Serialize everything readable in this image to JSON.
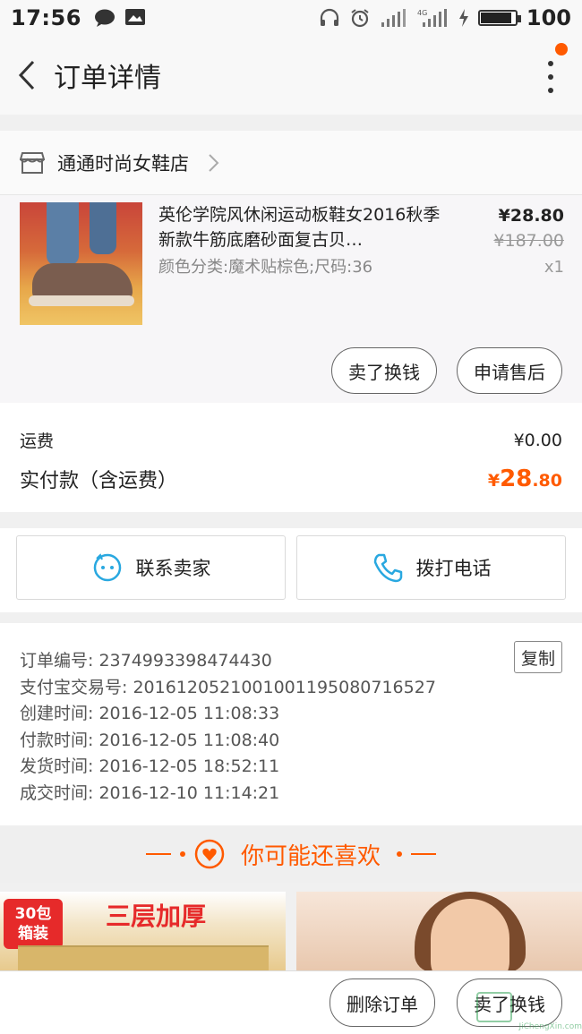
{
  "status_bar": {
    "time": "17:56",
    "battery": "100",
    "battery_level": 0.85
  },
  "nav": {
    "title": "订单详情"
  },
  "shop": {
    "name": "通通时尚女鞋店",
    "item": {
      "title": "英伦学院风休闲运动板鞋女2016秋季新款牛筋底磨砂面复古贝…",
      "sku": "颜色分类:魔术贴棕色;尺码:36",
      "price": "¥28.80",
      "original_price": "¥187.00",
      "quantity": "x1"
    },
    "actions": {
      "sell": "卖了换钱",
      "after_sale": "申请售后"
    }
  },
  "payment": {
    "shipping_label": "运费",
    "shipping_value": "¥0.00",
    "total_label": "实付款（含运费）",
    "total_currency": "¥",
    "total_int": "28",
    "total_dec": ".80"
  },
  "contact": {
    "seller": "联系卖家",
    "phone": "拨打电话"
  },
  "order_info": {
    "copy": "复制",
    "lines": [
      "订单编号: 2374993398474430",
      "支付宝交易号: 2016120521001001195080716527",
      "创建时间: 2016-12-05 11:08:33",
      "付款时间: 2016-12-05 11:08:40",
      "发货时间: 2016-12-05 18:52:11",
      "成交时间: 2016-12-10 11:14:21"
    ]
  },
  "recommend": {
    "title": "你可能还喜欢",
    "left_badge_1": "30包",
    "left_badge_2": "箱装",
    "left_promo": "三层加厚"
  },
  "bottom": {
    "delete": "删除订单",
    "sell": "卖了换钱"
  },
  "colors": {
    "accent": "#ff5a00",
    "contact_icon": "#29a8e0"
  }
}
